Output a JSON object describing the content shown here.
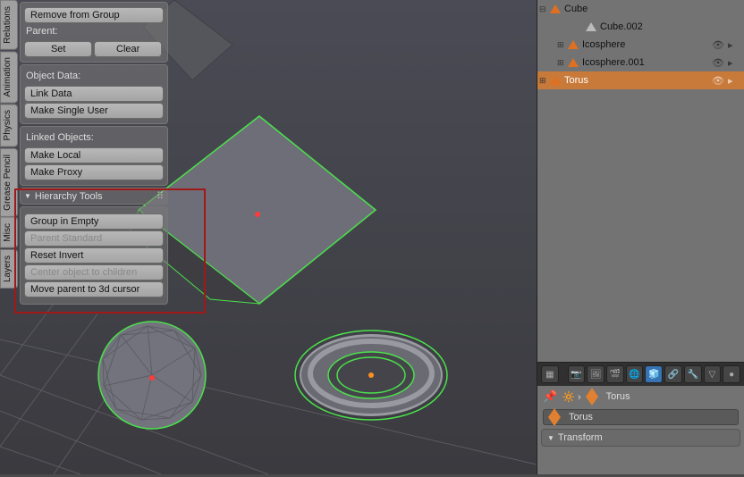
{
  "tabs": [
    "Relations",
    "Animation",
    "Physics",
    "Grease Pencil",
    "Misc",
    "Layers"
  ],
  "panel": {
    "remove_from_group": "Remove from Group",
    "parent_label": "Parent:",
    "set": "Set",
    "clear": "Clear",
    "object_data_label": "Object Data:",
    "link_data": "Link Data",
    "make_single_user": "Make Single User",
    "linked_objects_label": "Linked Objects:",
    "make_local": "Make Local",
    "make_proxy": "Make Proxy",
    "hierarchy_tools": "Hierarchy Tools",
    "group_in_empty": "Group in Empty",
    "parent_standard": "Parent Standard",
    "reset_invert": "Reset Invert",
    "center_object": "Center object to children",
    "move_parent_cursor": "Move parent to 3d cursor"
  },
  "outliner": {
    "items": [
      {
        "name": "Cube",
        "level": 0,
        "sel": false,
        "exp": "⊟"
      },
      {
        "name": "Cube.002",
        "level": 1,
        "sel": false,
        "grey": true,
        "exp": ""
      },
      {
        "name": "Icosphere",
        "level": 1,
        "sel": false,
        "exp": "⊞",
        "icons": true
      },
      {
        "name": "Icosphere.001",
        "level": 1,
        "sel": false,
        "exp": "⊞",
        "icons": true
      },
      {
        "name": "Torus",
        "level": 0,
        "sel": true,
        "exp": "⊞",
        "icons": true
      }
    ]
  },
  "properties": {
    "breadcrumb": "Torus",
    "name": "Torus",
    "transform_label": "Transform"
  }
}
